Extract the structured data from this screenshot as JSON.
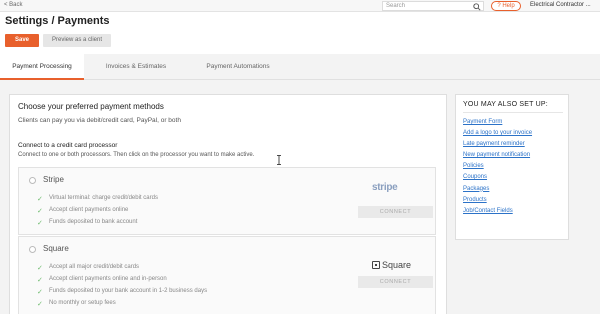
{
  "topbar": {
    "back_label": "< Back",
    "search_placeholder": "Search",
    "help_label": "? Help",
    "account_name": "Electrical Contractor ..."
  },
  "page": {
    "title": "Settings / Payments",
    "save_label": "Save",
    "preview_label": "Preview as a client"
  },
  "tabs": [
    {
      "label": "Payment Processing",
      "active": true
    },
    {
      "label": "Invoices & Estimates",
      "active": false
    },
    {
      "label": "Payment Automations",
      "active": false
    }
  ],
  "main": {
    "title": "Choose your preferred payment methods",
    "subtitle": "Clients can pay you via debit/credit card, PayPal, or both",
    "connect_title": "Connect to a credit card processor",
    "connect_subtitle": "Connect to one or both processors. Then click on the processor you want to make active.",
    "processors": [
      {
        "name": "Stripe",
        "logo_text": "stripe",
        "features": [
          "Virtual terminal: charge credit/debit cards",
          "Accept client payments online",
          "Funds deposited to bank account"
        ],
        "connect_label": "CONNECT"
      },
      {
        "name": "Square",
        "logo_text": "Square",
        "features": [
          "Accept all major credit/debit cards",
          "Accept client payments online and in-person",
          "Funds deposited to your bank account in 1-2 business days",
          "No monthly or setup fees"
        ],
        "connect_label": "CONNECT"
      }
    ]
  },
  "sidebar": {
    "title": "YOU MAY ALSO SET UP:",
    "links": [
      "Payment Form",
      "Add a logo to your invoice",
      "Late payment reminder",
      "New payment notification",
      "Policies",
      "Coupons",
      "Packages",
      "Products",
      "Job/Contact Fields"
    ]
  },
  "colors": {
    "accent": "#e8602c",
    "link": "#2b72c8",
    "check": "#6dbb6d"
  }
}
